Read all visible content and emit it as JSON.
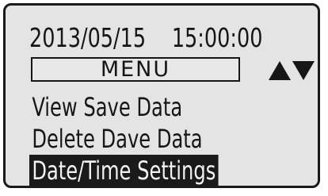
{
  "status": {
    "date": "2013/05/15",
    "time": "15:00:00"
  },
  "menu": {
    "title": "MENU",
    "scroll_up_icon": "triangle-up-icon",
    "scroll_down_icon": "triangle-down-icon",
    "items": [
      {
        "label": "View Save Data",
        "selected": false
      },
      {
        "label": "Delete Dave Data",
        "selected": false
      },
      {
        "label": "Date/Time Settings",
        "selected": true
      }
    ]
  },
  "colors": {
    "screen_background": "#e4e4e4",
    "text": "#161616",
    "highlight_background": "#1a1a1a",
    "highlight_text": "#f2f2f2"
  }
}
